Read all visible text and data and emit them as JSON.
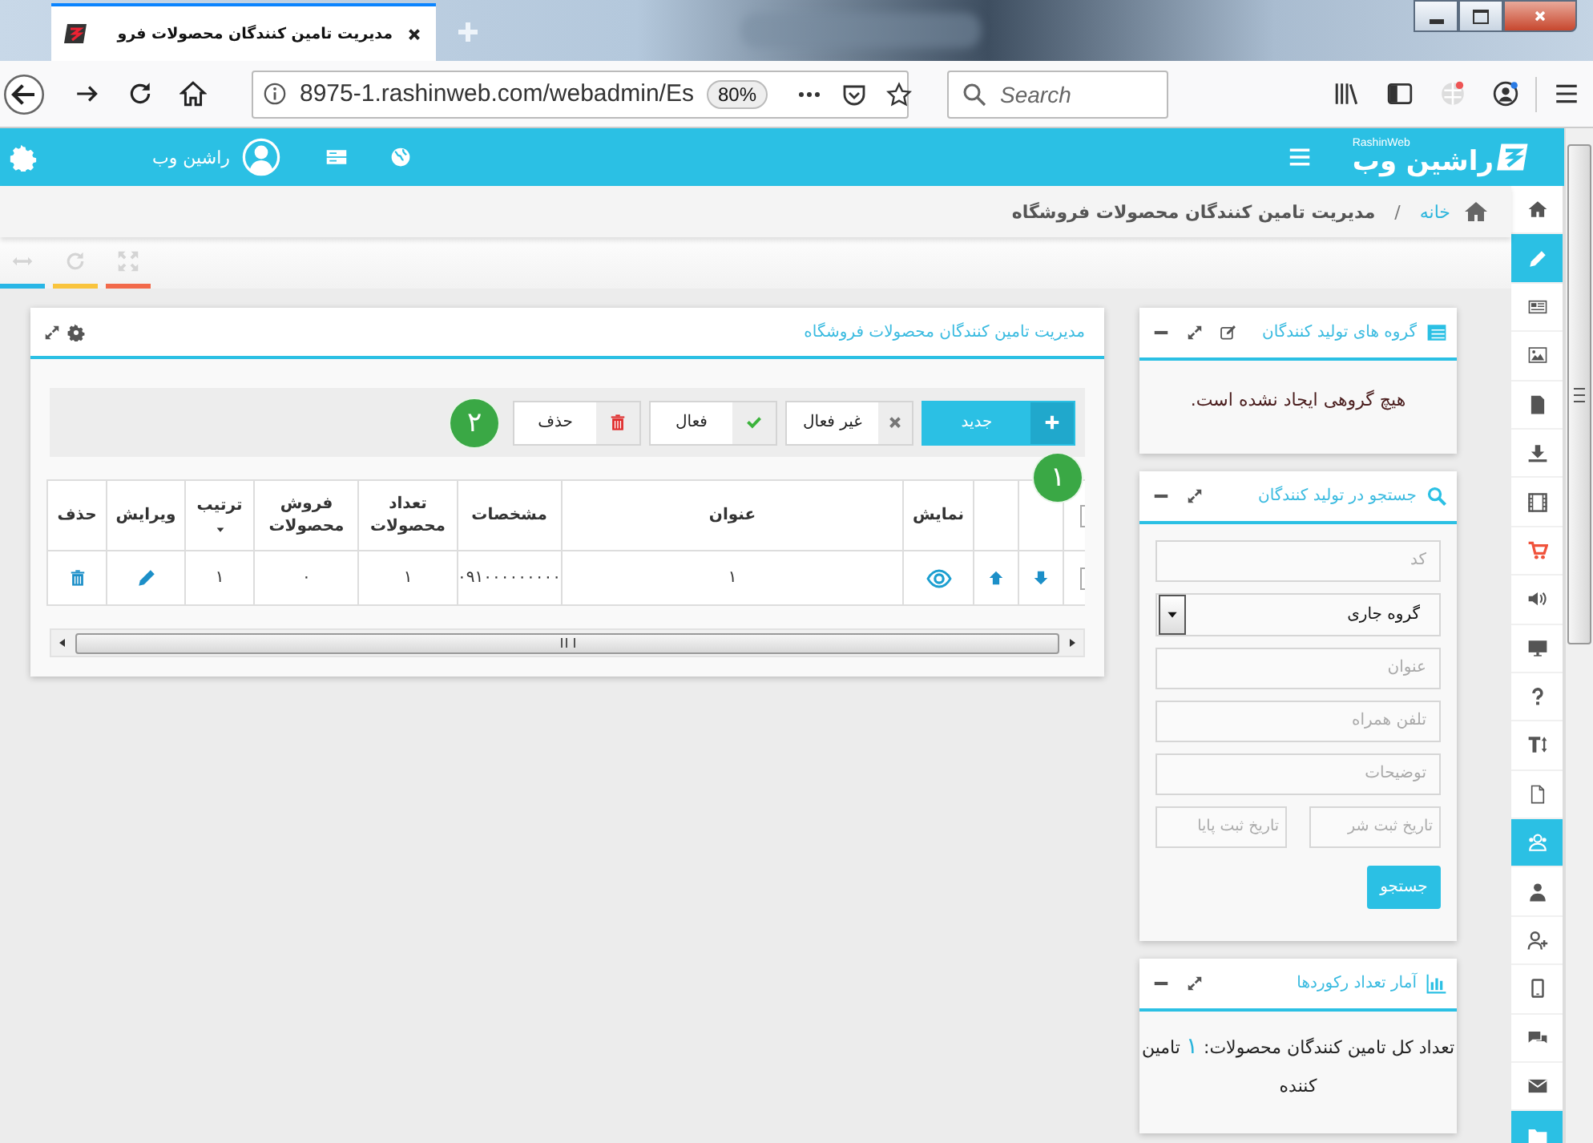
{
  "browser": {
    "tab_title": "مدیریت تامین کنندگان محصولات فرو",
    "url": "8975-1.rashinweb.com/webadmin/Es",
    "zoom": "80%",
    "search_placeholder": "Search"
  },
  "header": {
    "logo": "راشین وب",
    "logo_caption": "RashinWeb",
    "user_name": "راشین وب"
  },
  "breadcrumb": {
    "separator": "/",
    "items": [
      {
        "label": "خانه",
        "kind": "link"
      },
      {
        "label": "مدیریت تامین کنندگان محصولات فروشگاه",
        "kind": "current"
      }
    ]
  },
  "view_tools": [
    {
      "kind": "resize",
      "color": "#29b6e6"
    },
    {
      "kind": "refresh",
      "color": "#f9c43d"
    },
    {
      "kind": "fullscreen",
      "color": "#f26a4b"
    }
  ],
  "sidebar": [
    {
      "kind": "home",
      "selected": false
    },
    {
      "kind": "pencil",
      "selected": true
    },
    {
      "kind": "newspaper",
      "selected": false
    },
    {
      "kind": "image",
      "selected": false
    },
    {
      "kind": "file",
      "selected": false
    },
    {
      "kind": "download",
      "selected": false
    },
    {
      "kind": "film",
      "selected": false
    },
    {
      "kind": "cart",
      "selected": false
    },
    {
      "kind": "volume",
      "selected": false
    },
    {
      "kind": "monitor",
      "selected": false
    },
    {
      "kind": "question",
      "selected": false
    },
    {
      "kind": "text-height",
      "selected": false
    },
    {
      "kind": "file-blank",
      "selected": false
    },
    {
      "kind": "users",
      "selected": true
    },
    {
      "kind": "user",
      "selected": false
    },
    {
      "kind": "user-plus",
      "selected": false
    },
    {
      "kind": "mobile",
      "selected": false
    },
    {
      "kind": "comments",
      "selected": false
    },
    {
      "kind": "envelope",
      "selected": false
    },
    {
      "kind": "folder",
      "selected": true
    }
  ],
  "main_panel": {
    "title": "مدیریت تامین کنندگان محصولات فروشگاه",
    "actions": [
      {
        "kind": "new",
        "label": "جدید"
      },
      {
        "kind": "deactivate",
        "label": "غیر فعال"
      },
      {
        "kind": "activate",
        "label": "فعال"
      },
      {
        "kind": "delete",
        "label": "حذف"
      }
    ],
    "callouts": [
      "۱",
      "۲"
    ],
    "table": {
      "header_checked": false,
      "columns": [
        {
          "kind": "select"
        },
        {
          "kind": "move-down"
        },
        {
          "kind": "move-up"
        },
        {
          "kind": "view",
          "label": "نمایش"
        },
        {
          "kind": "text",
          "label": "عنوان"
        },
        {
          "kind": "text",
          "label": "مشخصات"
        },
        {
          "kind": "text",
          "label": "تعداد محصولات"
        },
        {
          "kind": "text",
          "label": "فروش محصولات"
        },
        {
          "kind": "sort",
          "label": "ترتیب"
        },
        {
          "kind": "edit",
          "label": "ویرایش"
        },
        {
          "kind": "delete",
          "label": "حذف"
        }
      ],
      "rows": [
        {
          "checked": false,
          "cells": [
            "",
            "",
            "",
            "",
            "۱",
            "۰۹۱۰۰۰۰۰۰۰۰۰",
            "۱",
            "۰",
            "۱",
            "",
            ""
          ]
        }
      ]
    }
  },
  "groups_panel": {
    "title": "گروه های تولید کنندگان",
    "message": "هیچ گروهی ایجاد نشده است."
  },
  "search_panel": {
    "title": "جستجو در تولید کنندگان",
    "fields": [
      {
        "kind": "input",
        "placeholder": "کد"
      },
      {
        "kind": "select",
        "value": "گروه جاری"
      },
      {
        "kind": "input",
        "placeholder": "عنوان"
      },
      {
        "kind": "input",
        "placeholder": "تلفن همراه"
      },
      {
        "kind": "input",
        "placeholder": "توضیحات"
      }
    ],
    "date_fields": [
      {
        "placeholder": "تاریخ ثبت شر"
      },
      {
        "placeholder": "تاریخ ثبت پایا"
      }
    ],
    "button": "جستجو"
  },
  "stats_panel": {
    "title": "آمار تعداد رکوردها",
    "label": "تعداد کل تامین کنندگان محصولات:",
    "count": "۱",
    "unit": "تامین کننده"
  }
}
